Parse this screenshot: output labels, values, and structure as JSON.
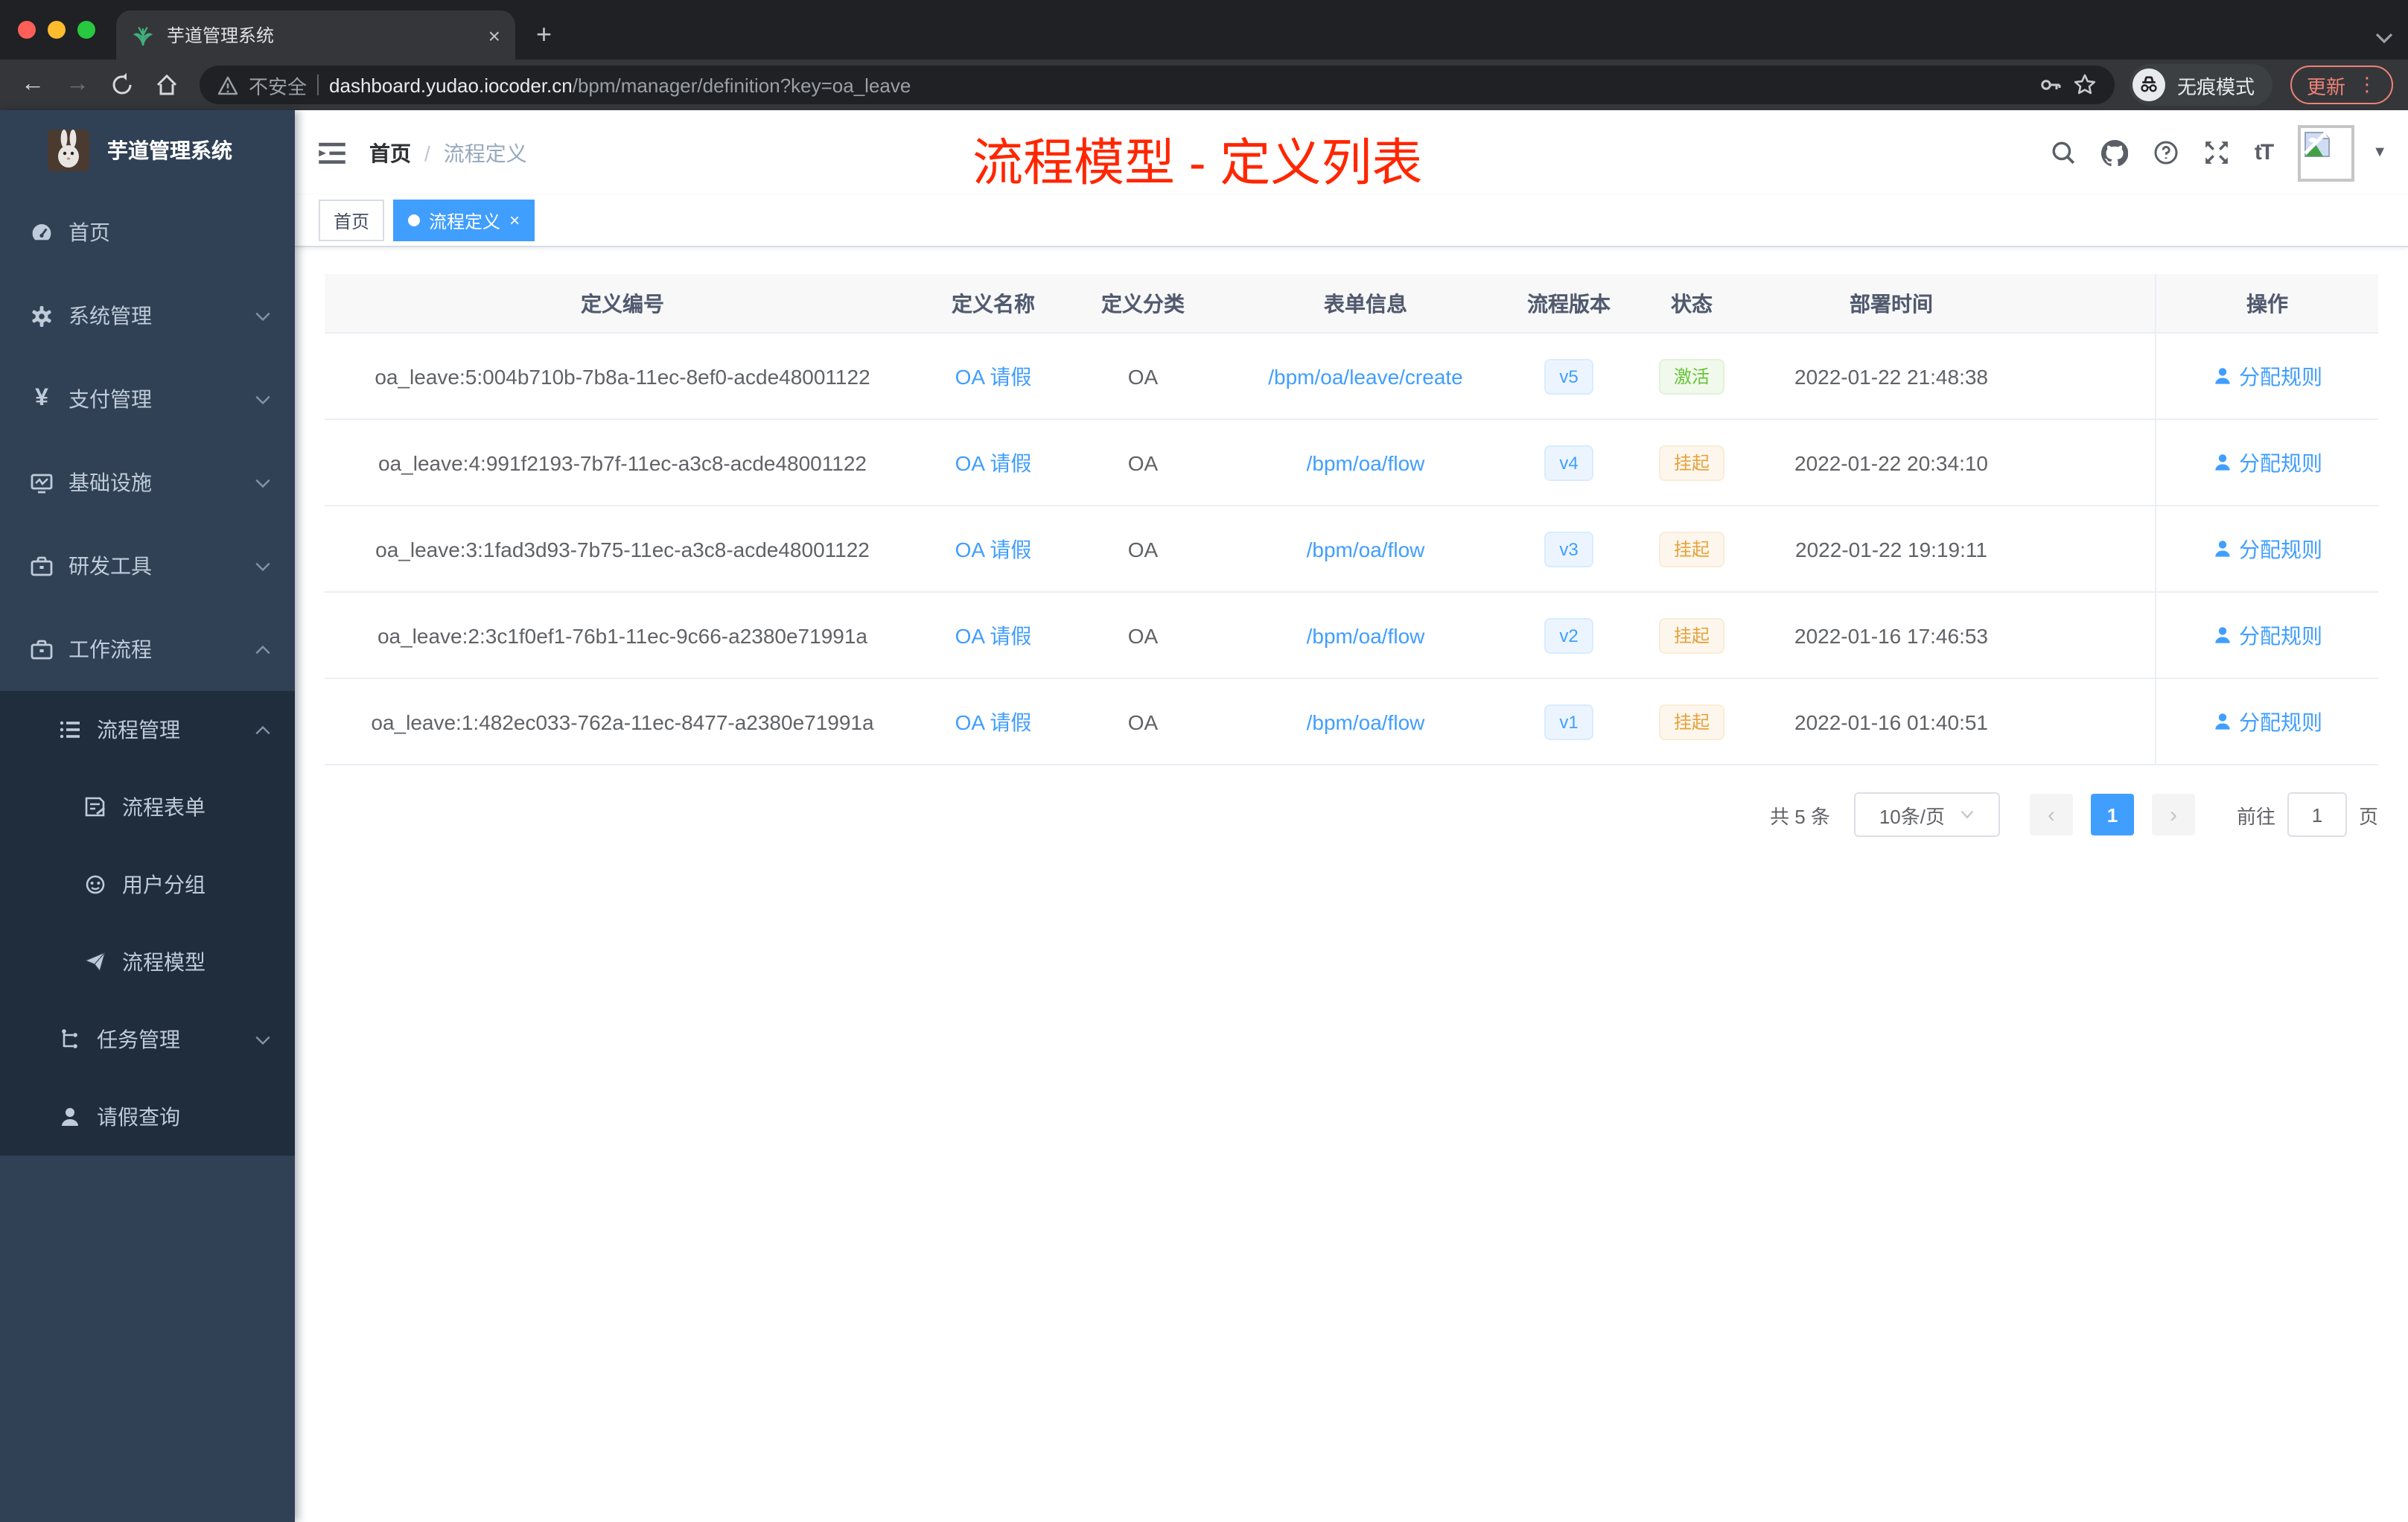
{
  "browser": {
    "tab": {
      "title": "芋道管理系统"
    },
    "toolbar": {
      "security_label": "不安全",
      "url_host": "dashboard.yudao.iocoder.cn",
      "url_path": "/bpm/manager/definition?key=oa_leave",
      "incognito_label": "无痕模式",
      "update_label": "更新"
    }
  },
  "icons": {
    "close": "×",
    "new_tab": "+",
    "ellipsis_v": "⋮",
    "yen": "¥",
    "font_size": "tT",
    "caret_down": "▼",
    "prev": "‹",
    "next": "›",
    "back": "←",
    "forward": "→"
  },
  "sidebar": {
    "app_title": "芋道管理系统",
    "menu": [
      {
        "label": "首页"
      },
      {
        "label": "系统管理"
      },
      {
        "label": "支付管理"
      },
      {
        "label": "基础设施"
      },
      {
        "label": "研发工具"
      },
      {
        "label": "工作流程"
      }
    ],
    "submenu": [
      {
        "label": "流程管理"
      },
      {
        "label": "流程表单"
      },
      {
        "label": "用户分组"
      },
      {
        "label": "流程模型"
      },
      {
        "label": "任务管理"
      },
      {
        "label": "请假查询"
      }
    ]
  },
  "header": {
    "breadcrumb_home": "首页",
    "breadcrumb_sep": "/",
    "breadcrumb_current": "流程定义",
    "overlay_title": "流程模型 - 定义列表"
  },
  "tags": {
    "home": "首页",
    "active": "流程定义"
  },
  "table": {
    "columns": {
      "id": "定义编号",
      "name": "定义名称",
      "category": "定义分类",
      "form": "表单信息",
      "version": "流程版本",
      "status": "状态",
      "deploy_time": "部署时间",
      "actions": "操作"
    },
    "rows": [
      {
        "id": "oa_leave:5:004b710b-7b8a-11ec-8ef0-acde48001122",
        "name": "OA 请假",
        "category": "OA",
        "form": "/bpm/oa/leave/create",
        "version": "v5",
        "status": "激活",
        "deploy_time": "2022-01-22 21:48:38",
        "action": "分配规则"
      },
      {
        "id": "oa_leave:4:991f2193-7b7f-11ec-a3c8-acde48001122",
        "name": "OA 请假",
        "category": "OA",
        "form": "/bpm/oa/flow",
        "version": "v4",
        "status": "挂起",
        "deploy_time": "2022-01-22 20:34:10",
        "action": "分配规则"
      },
      {
        "id": "oa_leave:3:1fad3d93-7b75-11ec-a3c8-acde48001122",
        "name": "OA 请假",
        "category": "OA",
        "form": "/bpm/oa/flow",
        "version": "v3",
        "status": "挂起",
        "deploy_time": "2022-01-22 19:19:11",
        "action": "分配规则"
      },
      {
        "id": "oa_leave:2:3c1f0ef1-76b1-11ec-9c66-a2380e71991a",
        "name": "OA 请假",
        "category": "OA",
        "form": "/bpm/oa/flow",
        "version": "v2",
        "status": "挂起",
        "deploy_time": "2022-01-16 17:46:53",
        "action": "分配规则"
      },
      {
        "id": "oa_leave:1:482ec033-762a-11ec-8477-a2380e71991a",
        "name": "OA 请假",
        "category": "OA",
        "form": "/bpm/oa/flow",
        "version": "v1",
        "status": "挂起",
        "deploy_time": "2022-01-16 01:40:51",
        "action": "分配规则"
      }
    ]
  },
  "pagination": {
    "total": "共 5 条",
    "page_size": "10条/页",
    "page": "1",
    "goto_label": "前往",
    "goto_value": "1",
    "page_unit": "页"
  },
  "colors": {
    "accent": "#409eff",
    "status_active": "#67c23a",
    "status_suspended": "#e6a23c",
    "sidebar_bg": "#304156",
    "submenu_bg": "#1f2d3d",
    "annotation_red": "#ff2600"
  }
}
